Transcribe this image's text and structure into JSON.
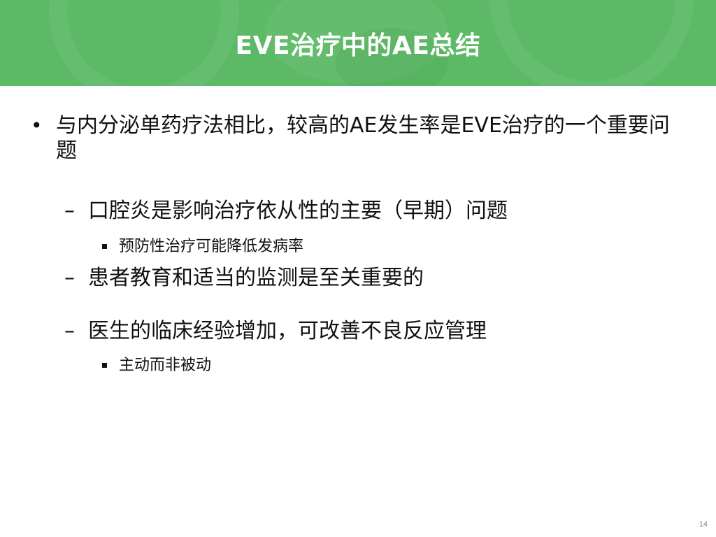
{
  "slide": {
    "title": "EVE治疗中的AE总结",
    "page_number": "14",
    "header_color": "#5cba66",
    "bullets": {
      "main": {
        "marker": "•",
        "text": "与内分泌单药疗法相比，较高的AE发生率是EVE治疗的一个重要问题"
      },
      "sub1": {
        "marker": "–",
        "text": "口腔炎是影响治疗依从性的主要（早期）问题"
      },
      "sub1_detail": {
        "text": "预防性治疗可能降低发病率"
      },
      "sub2": {
        "marker": "–",
        "text": "患者教育和适当的监测是至关重要的"
      },
      "sub3": {
        "marker": "–",
        "text": "医生的临床经验增加，可改善不良反应管理"
      },
      "sub3_detail": {
        "text": "主动而非被动"
      }
    }
  }
}
